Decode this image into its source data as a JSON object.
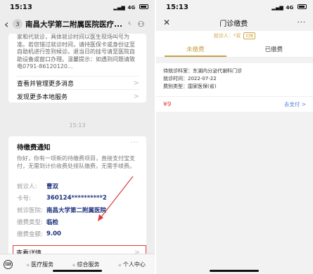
{
  "left": {
    "status": {
      "time": "15:13",
      "signal": "4G"
    },
    "header": {
      "badge": "3",
      "title": "南昌大学第二附属医院医疗..."
    },
    "card1": {
      "text": "家和代就诊，具体就诊时间以医生现场叫号为准。若您错过就诊时间，请持医保卡或身份证至自助机进行签到候诊。退当日的挂号请至医院自助设备或窗口办理。温馨提示：如遇到问题请致电0791-86120120...",
      "items": [
        {
          "label": "查看并管理更多消息"
        },
        {
          "label": "发现更多本地服务"
        }
      ]
    },
    "timestamp": "15:13",
    "notice": {
      "title": "待缴费通知",
      "desc": "你好，你有一项新的待缴费项目，直接支付宝支付，无需到计价收费处排队缴费，无需手续费。",
      "fields": [
        {
          "label": "就诊人:",
          "value": "曹双"
        },
        {
          "label": "卡号:",
          "value": "360124**********2"
        },
        {
          "label": "就诊医院:",
          "value": "南昌大学第二附属医院"
        },
        {
          "label": "缴费类型:",
          "value": "临检"
        },
        {
          "label": "缴费金额:",
          "value": "9.00"
        }
      ],
      "detail_label": "查看详情"
    },
    "bottom": {
      "tabs": [
        {
          "label": "医疗服务"
        },
        {
          "label": "综合服务"
        },
        {
          "label": "个人中心"
        }
      ]
    }
  },
  "right": {
    "status": {
      "time": "15:13",
      "signal": "4G"
    },
    "header": {
      "title": "门诊缴费"
    },
    "patient": {
      "text": "就诊人：*双",
      "switch": "切换"
    },
    "tabs": [
      {
        "label": "未缴费"
      },
      {
        "label": "已缴费"
      }
    ],
    "record": {
      "dept": "待就诊科室：东湖内分泌代谢科门诊",
      "time": "就诊时间：2022-07-22",
      "type": "费别类型：国家医保(省)",
      "amount": "¥9",
      "pay_label": "去支付 >"
    }
  },
  "colors": {
    "accent_gold": "#c8a046",
    "pay_red": "#e24545",
    "link_blue": "#4a7fd6",
    "highlight_red": "#e03a3a"
  }
}
